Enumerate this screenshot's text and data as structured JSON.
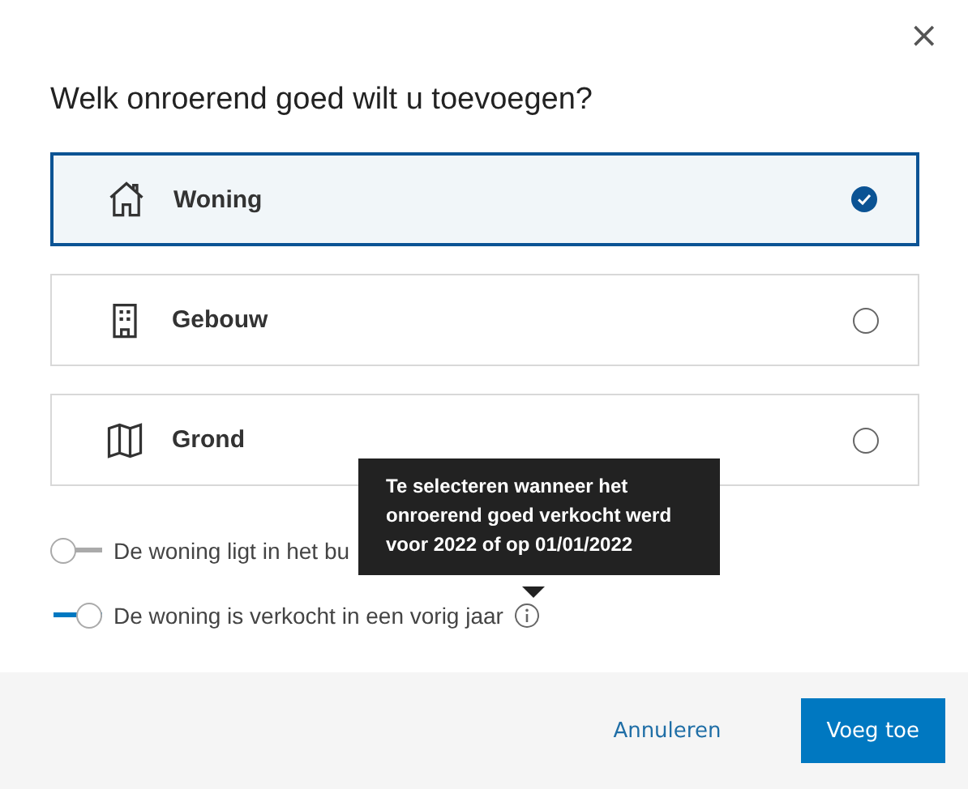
{
  "dialog": {
    "close": "×",
    "title": "Welk onroerend goed wilt u toevoegen?"
  },
  "options": [
    {
      "kind": "house",
      "label": "Woning",
      "selected": true
    },
    {
      "kind": "building",
      "label": "Gebouw",
      "selected": false
    },
    {
      "kind": "map",
      "label": "Grond",
      "selected": false
    }
  ],
  "toggles": [
    {
      "label": "De woning ligt in het bu",
      "on": false,
      "info": false
    },
    {
      "label": "De woning is verkocht in een vorig jaar",
      "on": true,
      "info": true
    }
  ],
  "tooltip": {
    "text": "Te selecteren wanneer het onroerend goed verkocht werd voor 2022 of op 01/01/2022"
  },
  "buttons": [
    {
      "kind": "secondary",
      "label": "Annuleren"
    },
    {
      "kind": "primary",
      "label": "Voeg toe"
    }
  ]
}
